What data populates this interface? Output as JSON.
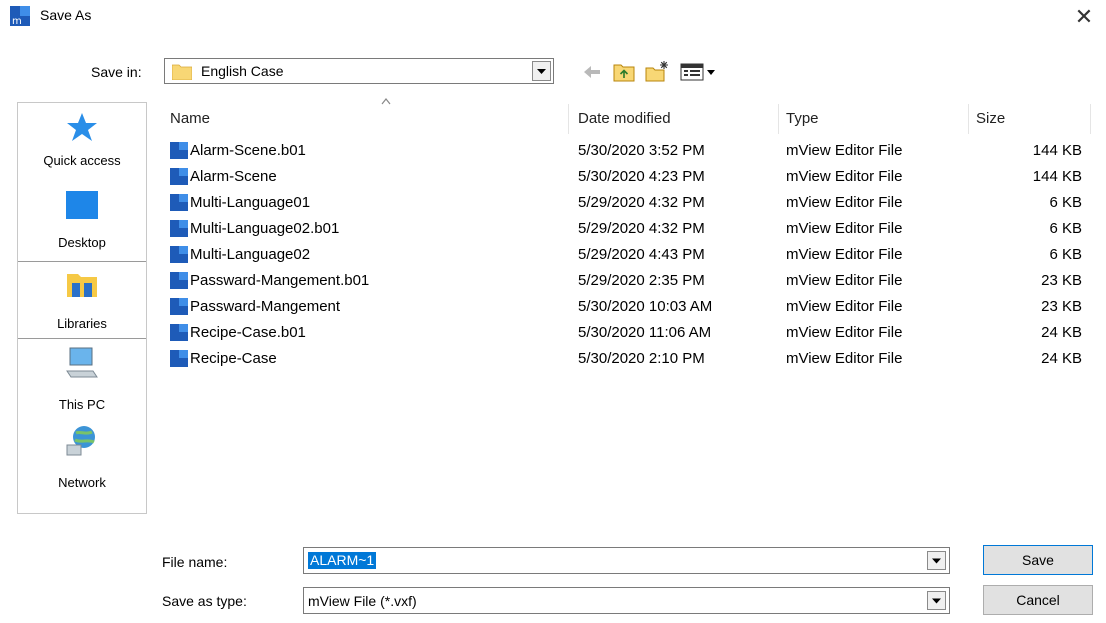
{
  "window": {
    "title": "Save As",
    "close_glyph": "✕"
  },
  "save_in": {
    "label": "Save in:",
    "value": "English Case"
  },
  "places": [
    {
      "label": "Quick access",
      "icon": "star-icon"
    },
    {
      "label": "Desktop",
      "icon": "desktop-icon"
    },
    {
      "label": "Libraries",
      "icon": "libraries-icon"
    },
    {
      "label": "This PC",
      "icon": "computer-icon"
    },
    {
      "label": "Network",
      "icon": "network-icon"
    }
  ],
  "columns": {
    "name": "Name",
    "date": "Date modified",
    "type": "Type",
    "size": "Size"
  },
  "files": [
    {
      "name": "Alarm-Scene.b01",
      "date": "5/30/2020 3:52 PM",
      "type": "mView Editor File",
      "size": "144 KB"
    },
    {
      "name": "Alarm-Scene",
      "date": "5/30/2020 4:23 PM",
      "type": "mView Editor File",
      "size": "144 KB"
    },
    {
      "name": "Multi-Language01",
      "date": "5/29/2020 4:32 PM",
      "type": "mView Editor File",
      "size": "6 KB"
    },
    {
      "name": "Multi-Language02.b01",
      "date": "5/29/2020 4:32 PM",
      "type": "mView Editor File",
      "size": "6 KB"
    },
    {
      "name": "Multi-Language02",
      "date": "5/29/2020 4:43 PM",
      "type": "mView Editor File",
      "size": "6 KB"
    },
    {
      "name": "Passward-Mangement.b01",
      "date": "5/29/2020 2:35 PM",
      "type": "mView Editor File",
      "size": "23 KB"
    },
    {
      "name": "Passward-Mangement",
      "date": "5/30/2020 10:03 AM",
      "type": "mView Editor File",
      "size": "23 KB"
    },
    {
      "name": "Recipe-Case.b01",
      "date": "5/30/2020 11:06 AM",
      "type": "mView Editor File",
      "size": "24 KB"
    },
    {
      "name": "Recipe-Case",
      "date": "5/30/2020 2:10 PM",
      "type": "mView Editor File",
      "size": "24 KB"
    }
  ],
  "file_name": {
    "label": "File name:",
    "value": "ALARM~1"
  },
  "save_as_type": {
    "label": "Save as type:",
    "value": "mView File (*.vxf)"
  },
  "buttons": {
    "save": "Save",
    "cancel": "Cancel"
  },
  "colors": {
    "accent": "#0078d7",
    "folder": "#f8d775",
    "file_icon": "#1e5bb8"
  }
}
